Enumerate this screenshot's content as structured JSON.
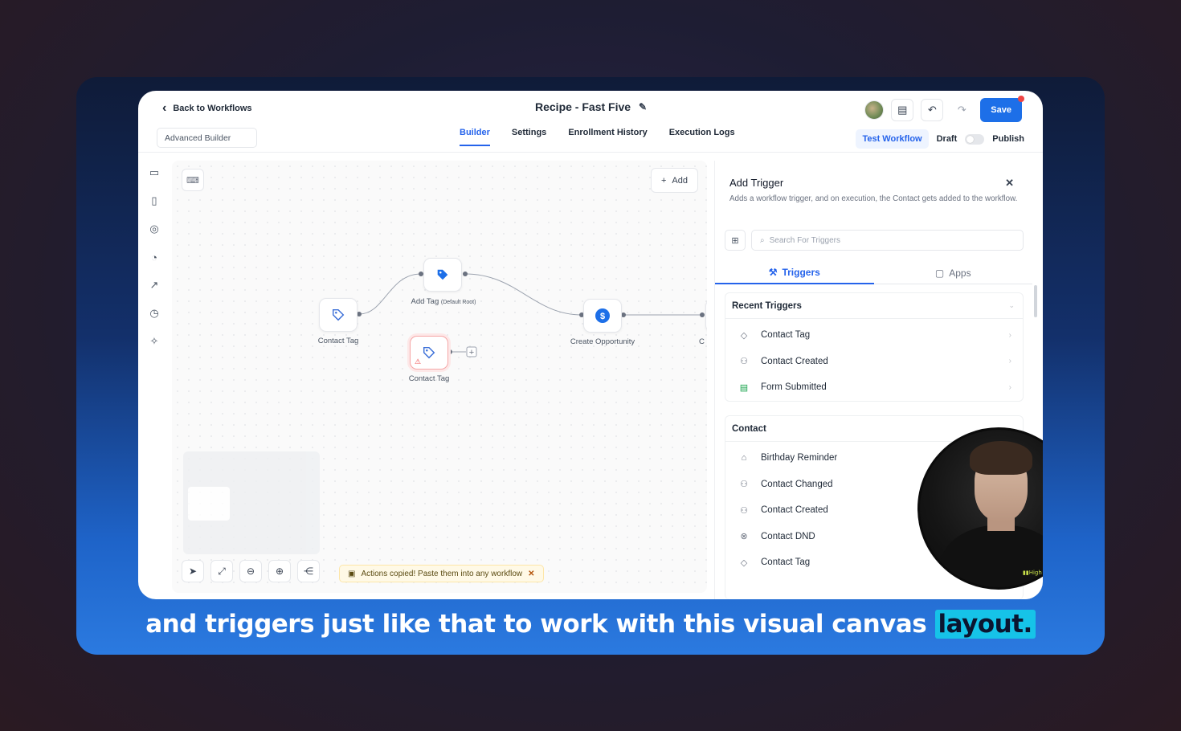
{
  "header": {
    "back_label": "Back to Workflows",
    "workflow_title": "Recipe - Fast Five",
    "save_label": "Save",
    "builder_mode": "Advanced Builder",
    "tabs": [
      {
        "label": "Builder",
        "active": true
      },
      {
        "label": "Settings",
        "active": false
      },
      {
        "label": "Enrollment History",
        "active": false
      },
      {
        "label": "Execution Logs",
        "active": false
      }
    ],
    "test_workflow_label": "Test Workflow",
    "draft_label": "Draft",
    "publish_label": "Publish"
  },
  "canvas": {
    "add_label": "Add",
    "nodes": [
      {
        "label": "Contact Tag",
        "icon": "tag-icon"
      },
      {
        "label": "Add Tag",
        "sublabel": "(Default Root)",
        "icon": "tag-filled-icon"
      },
      {
        "label": "Contact Tag",
        "icon": "tag-icon",
        "warning": true
      },
      {
        "label": "Create Opportunity",
        "icon": "dollar-icon"
      },
      {
        "label": "C Con",
        "icon": "partial-node"
      }
    ],
    "toast": "Actions copied! Paste them into any workflow"
  },
  "panel": {
    "title": "Add Trigger",
    "description": "Adds a workflow trigger, and on execution, the Contact gets added to the workflow.",
    "search_placeholder": "Search For Triggers",
    "tabs": [
      {
        "label": "Triggers",
        "active": true
      },
      {
        "label": "Apps",
        "active": false
      }
    ],
    "recent": {
      "title": "Recent Triggers",
      "items": [
        {
          "label": "Contact Tag",
          "icon": "tag-icon"
        },
        {
          "label": "Contact Created",
          "icon": "user-plus-icon"
        },
        {
          "label": "Form Submitted",
          "icon": "clipboard-icon"
        }
      ]
    },
    "contact": {
      "title": "Contact",
      "items": [
        {
          "label": "Birthday Reminder",
          "icon": "cake-icon"
        },
        {
          "label": "Contact Changed",
          "icon": "users-icon"
        },
        {
          "label": "Contact Created",
          "icon": "user-plus-icon"
        },
        {
          "label": "Contact DND",
          "icon": "block-icon"
        },
        {
          "label": "Contact Tag",
          "icon": "tag-icon"
        }
      ]
    }
  },
  "caption": {
    "text": "and triggers just like that to work with this visual canvas",
    "highlight": "layout."
  },
  "colors": {
    "accent": "#2563eb",
    "save_button": "#1d6fe8",
    "caption_highlight": "#16c3e8"
  }
}
